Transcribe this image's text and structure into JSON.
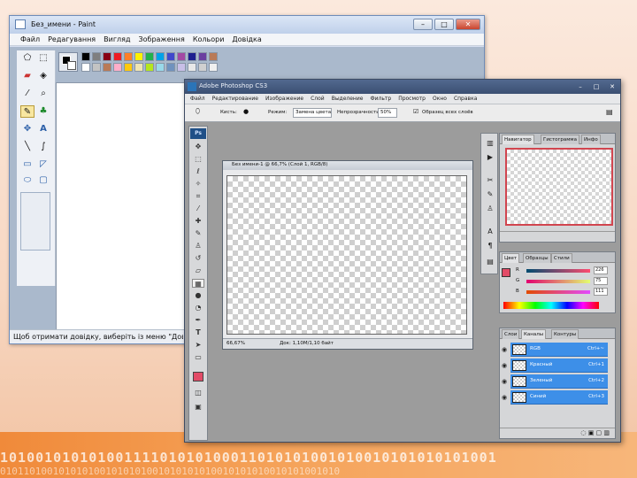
{
  "paint": {
    "title": "Без_имени - Paint",
    "menu": [
      "Файл",
      "Редагування",
      "Вигляд",
      "Зображення",
      "Кольори",
      "Довідка"
    ],
    "status": "Щоб отримати довідку, виберіть із меню \"Довідка\"",
    "palette_row1": [
      "#000000",
      "#7f7f7f",
      "#880015",
      "#ed1c24",
      "#ff7f27",
      "#fff200",
      "#22b14c",
      "#00a2e8",
      "#3f48cc",
      "#a349a4",
      "#1f1f8f",
      "#6a3fa0",
      "#b97a57"
    ],
    "palette_row2": [
      "#ffffff",
      "#c3c3c3",
      "#b97a57",
      "#ffaec9",
      "#ffc90e",
      "#efe4b0",
      "#b5e61d",
      "#99d9ea",
      "#7092be",
      "#c8bfe7",
      "#e8e8e8",
      "#d0d0d0",
      "#f0f0f0"
    ]
  },
  "ps": {
    "title": "Adobe Photoshop CS3",
    "menu": [
      "Файл",
      "Редактирование",
      "Изображение",
      "Слой",
      "Выделение",
      "Фильтр",
      "Просмотр",
      "Окно",
      "Справка"
    ],
    "options": {
      "brush_label": "Кисть:",
      "mode_label": "Режим:",
      "mode_value": "Замена цвета",
      "tolerance_label": "Непрозрачность:",
      "tolerance_value": "50%",
      "checkbox_label": "Образец всех слоёв"
    },
    "doc": {
      "title": "Без имени-1 @ 66,7% (Слой 1, RGB/8)",
      "zoom": "66,67%",
      "info": "Док: 1,10М/1,10 байт"
    },
    "navigator_tabs": [
      "Навигатор",
      "Гистограмма",
      "Инфо"
    ],
    "color_tabs": [
      "Цвет",
      "Образцы",
      "Стили"
    ],
    "color_sliders": [
      {
        "label": "R",
        "value": "226"
      },
      {
        "label": "G",
        "value": "75"
      },
      {
        "label": "B",
        "value": "111"
      }
    ],
    "layers_tabs": [
      "Слои",
      "Каналы",
      "Контуры"
    ],
    "channels": [
      {
        "name": "RGB",
        "shortcut": "Ctrl+~"
      },
      {
        "name": "Красный",
        "shortcut": "Ctrl+1"
      },
      {
        "name": "Зеленый",
        "shortcut": "Ctrl+2"
      },
      {
        "name": "Синий",
        "shortcut": "Ctrl+3"
      }
    ],
    "foreground_color": "#e24b67"
  },
  "background": {
    "binary_line1": "10100101010100111101010100011010101001010010101010101001",
    "binary_line2": "0101101001010101001010101001010101010010101010010101001010"
  }
}
